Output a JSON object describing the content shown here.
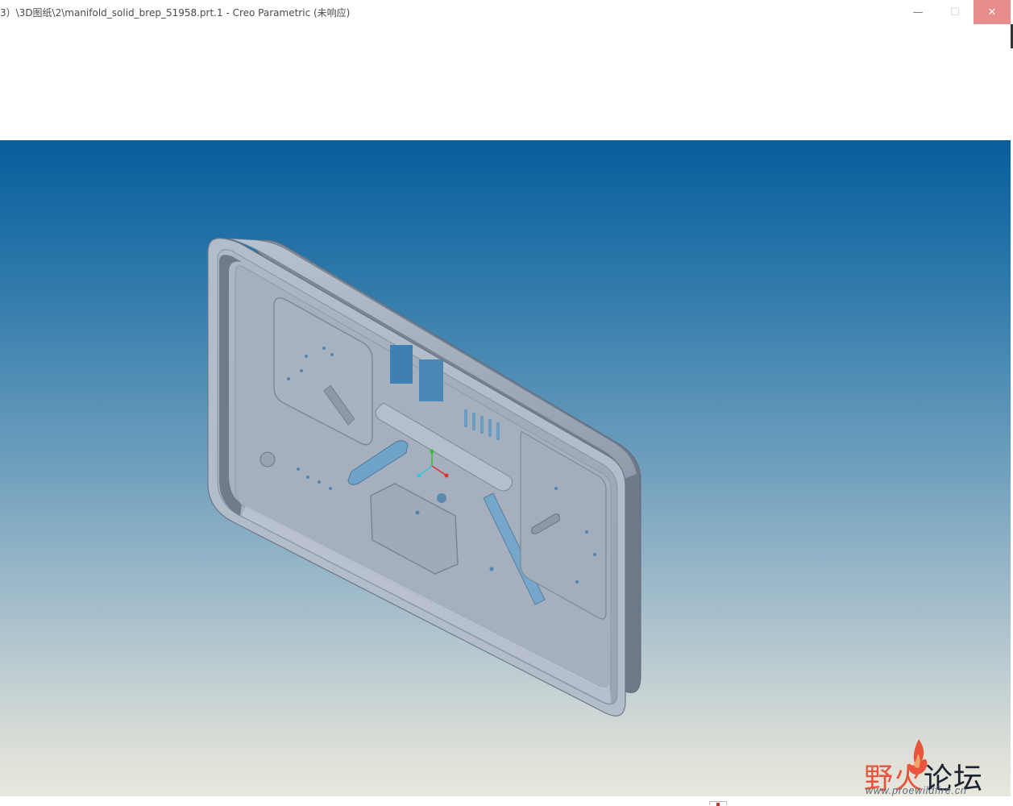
{
  "window": {
    "title": "3）\\3D图纸\\2\\manifold_solid_brep_51958.prt.1 - Creo Parametric (未响应)",
    "minimize_glyph": "—",
    "maximize_glyph": "☐",
    "close_glyph": "✕"
  },
  "watermark": {
    "chars": [
      "野",
      "火",
      "论",
      "坛"
    ],
    "url": "www.proewildfire.cn"
  },
  "colors": {
    "viewport_top": "#075e9c",
    "viewport_bottom": "#e8e7dc",
    "part_face": "#a3b0c0",
    "close_button": "#e88c8c",
    "axis_x": "#e03030",
    "axis_y": "#30c030",
    "axis_z": "#30c8e0"
  },
  "icons": {
    "csys": "coordinate-system-icon",
    "status": "message-flag-icon"
  }
}
